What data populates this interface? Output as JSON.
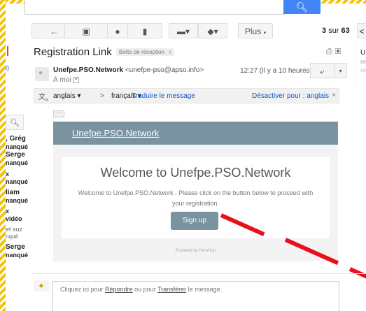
{
  "search": {
    "button_icon": "search-icon"
  },
  "toolbar": {
    "back_icon": "←",
    "archive_icon": "▣",
    "spam_icon": "●",
    "delete_icon": "▮",
    "folder_icon": "▬▾",
    "label_icon": "◆▾",
    "more_label": "Plus",
    "page_current": "3",
    "page_sep": "sur",
    "page_total": "63"
  },
  "sidebar": {
    "snippets": [
      ", Grég",
      "nanqué",
      "Serge",
      "nanqué",
      "x",
      "nanqué",
      "liam",
      "nanqué",
      "x",
      "vidéo",
      "et suz",
      "nqué",
      "Serge",
      "nanqué"
    ],
    "fragment": "i)"
  },
  "email": {
    "subject": "Registration Link",
    "inbox_tag": "Boîte de réception",
    "sender_name": "Unefpe.PSO.Network",
    "sender_email": "<unefpe-pso@apso.info>",
    "to_me": "À moi",
    "time": "12:27 (Il y a 10 heures)",
    "right_panel_letter": "U"
  },
  "translate": {
    "source_lang": "anglais",
    "target_lang": "français",
    "translate_link": "Traduire le message",
    "disable_link": "Désactiver pour : anglais"
  },
  "content": {
    "header_link": "Unefpe.PSO.Network",
    "welcome": "Welcome to Unefpe.PSO.Network",
    "body_line1": "Welcome to Unefpe.PSO.Network . Please click on the button below to proceed with",
    "body_line2": "your registration.",
    "signup_label": "Sign up",
    "powered": "Powered by HumHub"
  },
  "reply": {
    "prefix": "Cliquez ici pour",
    "reply_link": "Répondre",
    "middle": "ou pour",
    "forward_link": "Transférer",
    "suffix": "le message."
  }
}
